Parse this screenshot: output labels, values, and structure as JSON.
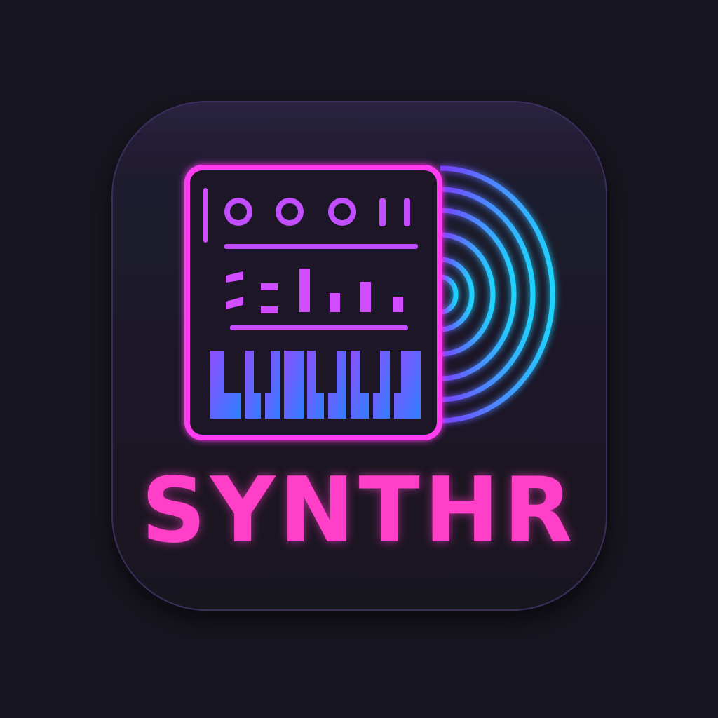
{
  "app": {
    "name": "SYNTHR"
  },
  "colors": {
    "background": "#17151f",
    "tile": "#1d1a29",
    "tile_edge": "#3a2f5c",
    "synth_outline": "#ff3cf0",
    "controls": "#c24dff",
    "keys_top": "#8a4dff",
    "keys_bottom": "#2f7bff",
    "record_arcs": "#1fd3ff",
    "wordmark": "#ff3fc8"
  },
  "icons": [
    "synthesizer-icon",
    "vinyl-record-icon",
    "knob-icon",
    "slider-icon",
    "piano-keys-icon"
  ]
}
